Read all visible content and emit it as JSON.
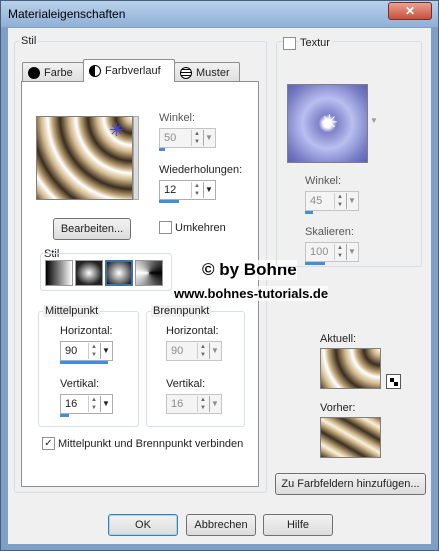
{
  "window": {
    "title": "Materialeigenschaften",
    "close_glyph": "✕"
  },
  "stil_group": {
    "label": "Stil"
  },
  "tabs": [
    {
      "label": "Farbe",
      "icon": "circle-black-icon"
    },
    {
      "label": "Farbverlauf",
      "icon": "half-circle-icon"
    },
    {
      "label": "Muster",
      "icon": "globe-icon"
    }
  ],
  "gradient": {
    "winkel_label": "Winkel:",
    "winkel_value": "50",
    "wiederholungen_label": "Wiederholungen:",
    "wiederholungen_value": "12",
    "bearbeiten_label": "Bearbeiten...",
    "umkehren_label": "Umkehren",
    "stil_label": "Stil",
    "mittelpunkt": {
      "label": "Mittelpunkt",
      "horizontal_label": "Horizontal:",
      "horizontal_value": "90",
      "vertikal_label": "Vertikal:",
      "vertikal_value": "16"
    },
    "brennpunkt": {
      "label": "Brennpunkt",
      "horizontal_label": "Horizontal:",
      "horizontal_value": "90",
      "vertikal_label": "Vertikal:",
      "vertikal_value": "16"
    },
    "verbinden_label": "Mittelpunkt und Brennpunkt verbinden",
    "verbinden_checked": "✓"
  },
  "watermark": {
    "line1": "© by Bohne",
    "line2": "www.bohnes-tutorials.de"
  },
  "texture": {
    "label": "Textur",
    "winkel_label": "Winkel:",
    "winkel_value": "45",
    "skalieren_label": "Skalieren:",
    "skalieren_value": "100"
  },
  "aktuell_label": "Aktuell:",
  "vorher_label": "Vorher:",
  "add_swatch_label": "Zu Farbfeldern hinzufügen...",
  "buttons": {
    "ok": "OK",
    "abbrechen": "Abbrechen",
    "hilfe": "Hilfe"
  }
}
